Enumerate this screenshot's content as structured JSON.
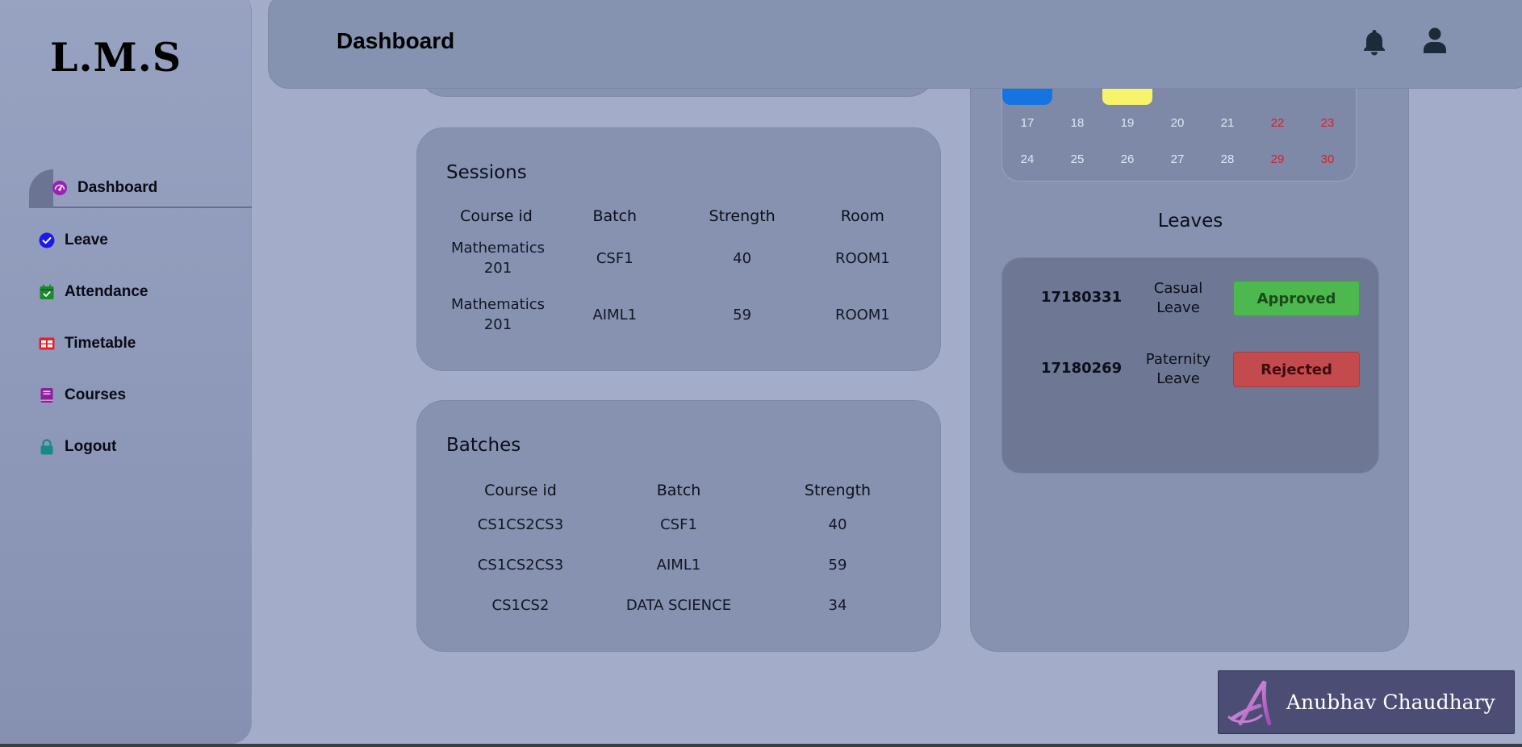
{
  "app": {
    "logo": "L.M.S"
  },
  "sidebar": {
    "items": [
      {
        "label": "Dashboard",
        "icon": "dashboard-gauge-icon",
        "color": "#9b1fb3",
        "active": true
      },
      {
        "label": "Leave",
        "icon": "check-circle-icon",
        "color": "#1d18f0"
      },
      {
        "label": "Attendance",
        "icon": "calendar-check-icon",
        "color": "#1c8a2c"
      },
      {
        "label": "Timetable",
        "icon": "table-grid-icon",
        "color": "#e3222b"
      },
      {
        "label": "Courses",
        "icon": "book-icon",
        "color": "#8e1f9a"
      },
      {
        "label": "Logout",
        "icon": "lock-icon",
        "color": "#178a86"
      }
    ]
  },
  "header": {
    "title": "Dashboard",
    "icons": [
      "bell-icon",
      "user-icon"
    ]
  },
  "sessions": {
    "title": "Sessions",
    "columns": [
      "Course id",
      "Batch",
      "Strength",
      "Room"
    ],
    "rows": [
      [
        "Mathematics 201",
        "CSF1",
        "40",
        "ROOM1"
      ],
      [
        "Mathematics 201",
        "AIML1",
        "59",
        "ROOM1"
      ]
    ]
  },
  "batches": {
    "title": "Batches",
    "columns": [
      "Course id",
      "Batch",
      "Strength"
    ],
    "rows": [
      [
        "CS1CS2CS3",
        "CSF1",
        "40"
      ],
      [
        "CS1CS2CS3",
        "AIML1",
        "59"
      ],
      [
        "CS1CS2",
        "DATA SCIENCE",
        "34"
      ]
    ]
  },
  "calendar": {
    "selected_color": "#1674e0",
    "today_color": "#f7f36a",
    "weeks": [
      [
        "17",
        "18",
        "19",
        "20",
        "21",
        "22",
        "23"
      ],
      [
        "24",
        "25",
        "26",
        "27",
        "28",
        "29",
        "30"
      ]
    ]
  },
  "leaves": {
    "title": "Leaves",
    "items": [
      {
        "id": "17180331",
        "type": "Casual Leave",
        "status": "Approved"
      },
      {
        "id": "17180269",
        "type": "Paternity Leave",
        "status": "Rejected"
      }
    ]
  },
  "watermark": {
    "name": "Anubhav Chaudhary"
  }
}
